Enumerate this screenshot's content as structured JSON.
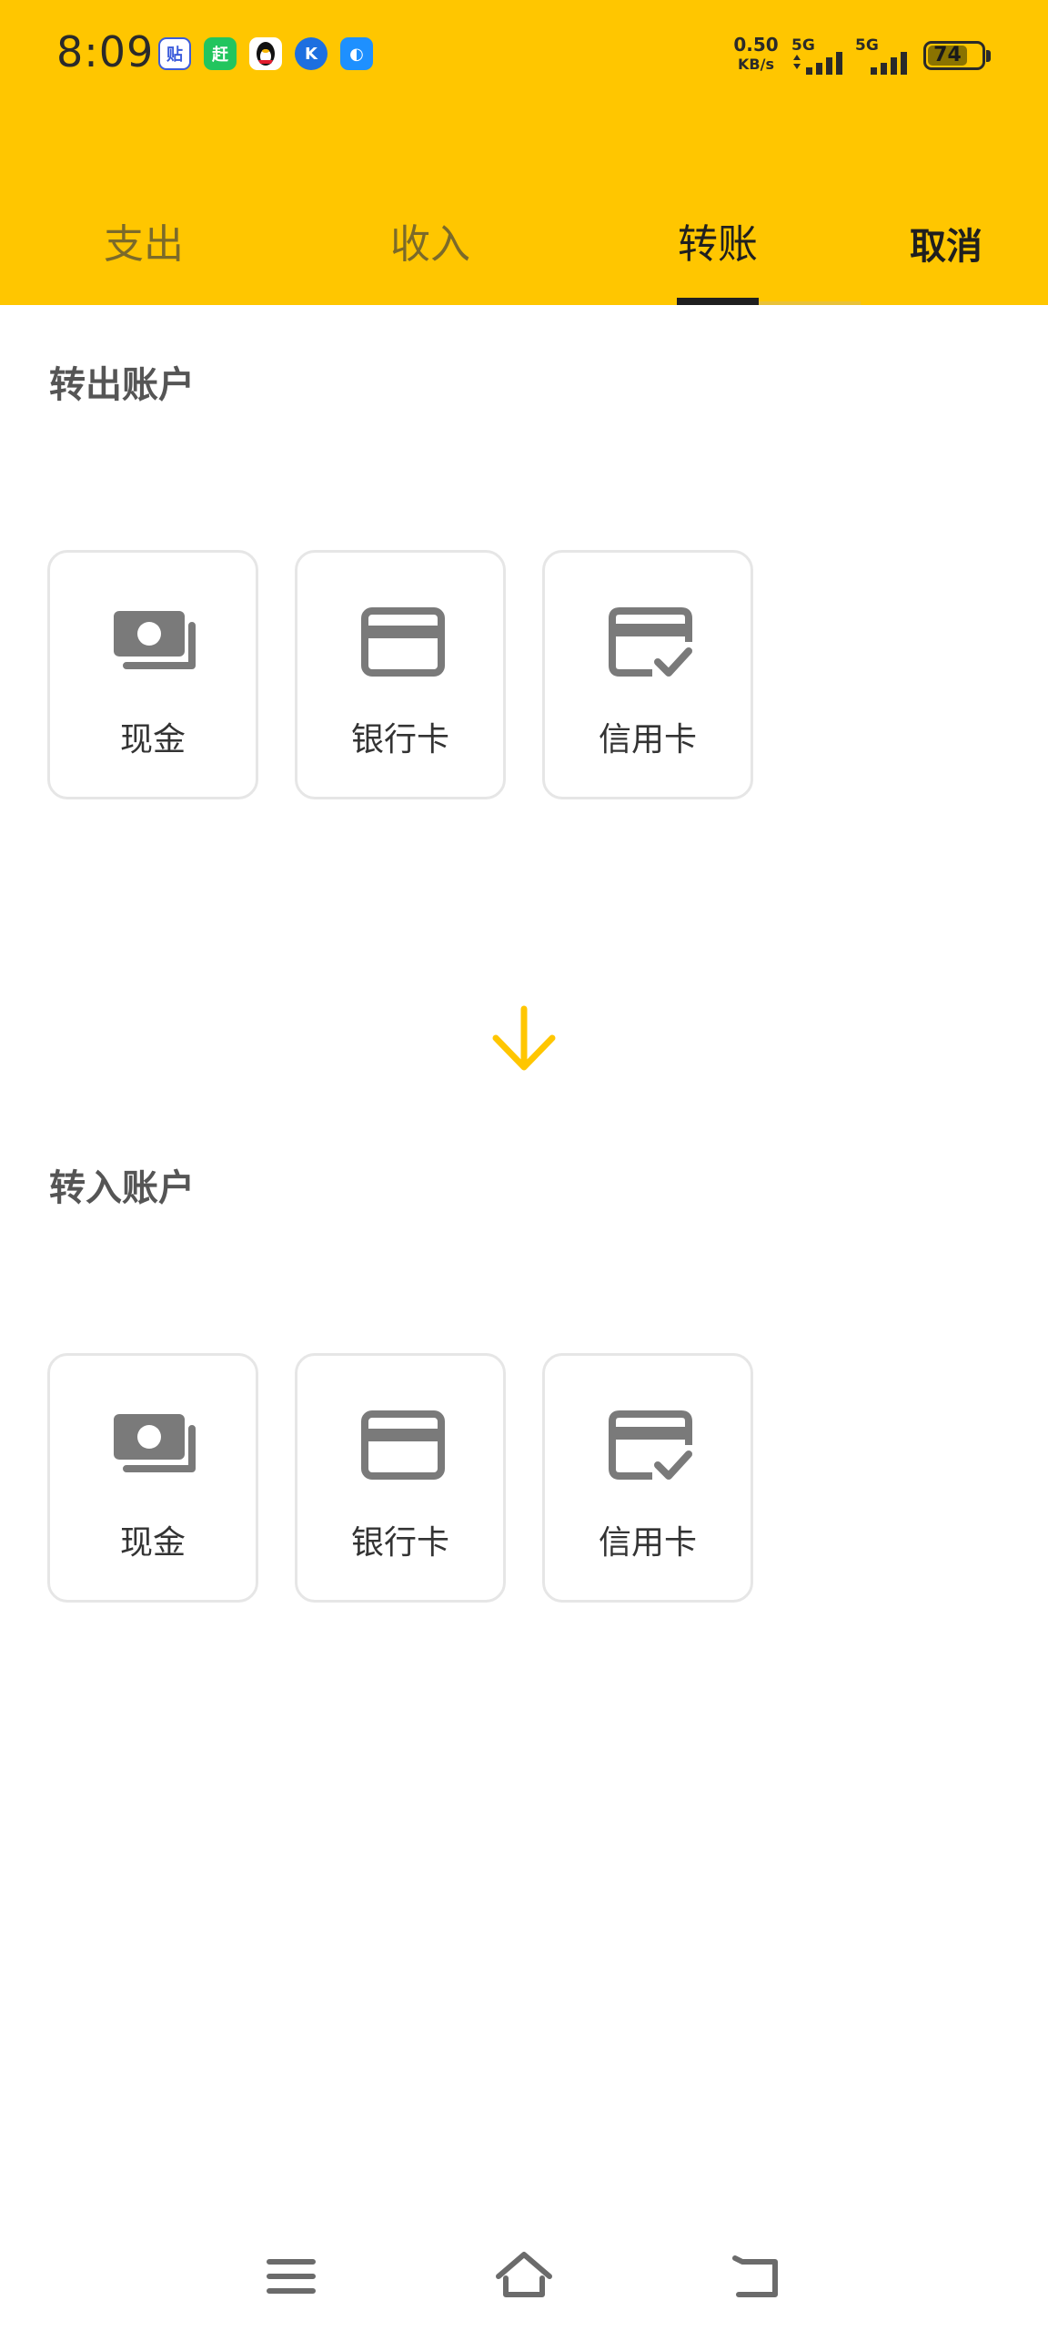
{
  "status_bar": {
    "time": "8:09",
    "app_icons": [
      {
        "name": "tieba-icon",
        "glyph": "贴",
        "color": "#3b82f6"
      },
      {
        "name": "wechat-green-app-icon",
        "glyph": "赶",
        "color": "#22c55e"
      },
      {
        "name": "qq-penguin-icon",
        "glyph": "🐧",
        "color": "#ffffff"
      },
      {
        "name": "k-app-icon",
        "glyph": "K",
        "color": "#1d6fe0"
      },
      {
        "name": "blue-app-icon",
        "glyph": "◐",
        "color": "#1e90ff"
      }
    ],
    "net_speed_value": "0.50",
    "net_speed_unit": "KB/s",
    "signal_1_label": "5G",
    "signal_2_label": "5G",
    "battery_level": "74",
    "battery_percent": 74
  },
  "tabs": [
    {
      "label": "支出",
      "active": false
    },
    {
      "label": "收入",
      "active": false
    },
    {
      "label": "转账",
      "active": true
    }
  ],
  "cancel_label": "取消",
  "transfer_out": {
    "title": "转出账户",
    "accounts": [
      {
        "label": "现金",
        "icon": "cash-icon"
      },
      {
        "label": "银行卡",
        "icon": "bank-card-icon"
      },
      {
        "label": "信用卡",
        "icon": "credit-card-icon"
      }
    ]
  },
  "transfer_in": {
    "title": "转入账户",
    "accounts": [
      {
        "label": "现金",
        "icon": "cash-icon"
      },
      {
        "label": "银行卡",
        "icon": "bank-card-icon"
      },
      {
        "label": "信用卡",
        "icon": "credit-card-icon"
      }
    ]
  },
  "colors": {
    "header_bg": "#FFC600",
    "arrow": "#FFC600",
    "icon_gray": "#7a7a7a"
  },
  "nav_bar": {
    "icons": [
      "menu-icon",
      "home-icon",
      "back-icon"
    ]
  }
}
